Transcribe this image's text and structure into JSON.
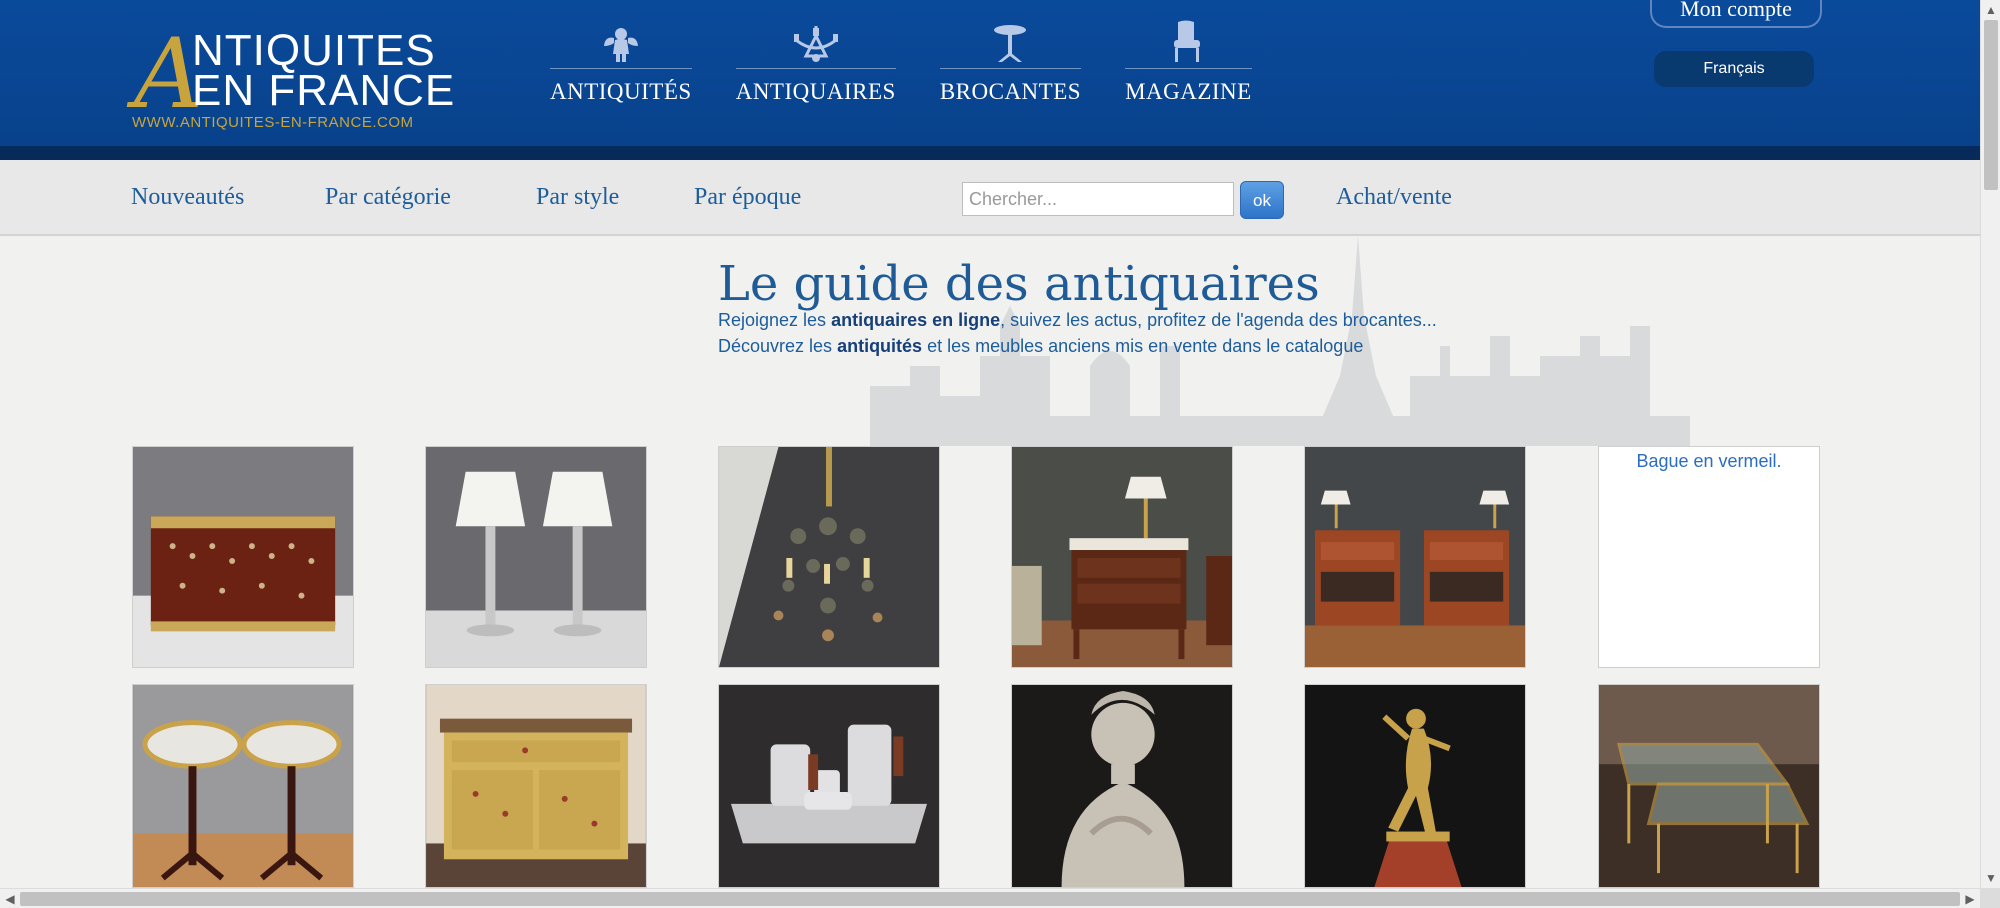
{
  "header": {
    "logo": {
      "initial": "A",
      "line1": "NTIQUITES",
      "line2": "EN FRANCE",
      "url": "WWW.ANTIQUITES-EN-FRANCE.COM"
    },
    "main_nav": [
      {
        "label": "ANTIQUITÉS",
        "icon": "cherub-icon"
      },
      {
        "label": "ANTIQUAIRES",
        "icon": "chandelier-icon"
      },
      {
        "label": "BROCANTES",
        "icon": "gueridon-table-icon"
      },
      {
        "label": "MAGAZINE",
        "icon": "armchair-icon"
      }
    ],
    "account_label": "Mon compte",
    "language": "Français"
  },
  "subnav": {
    "links": [
      "Nouveautés",
      "Par catégorie",
      "Par style",
      "Par époque"
    ],
    "search_placeholder": "Chercher...",
    "search_button": "ok",
    "buy_sell": "Achat/vente"
  },
  "intro": {
    "title": "Le guide des antiquaires",
    "line1": {
      "before": "Rejoignez les ",
      "bold": "antiquaires en ligne",
      "after": ", suivez les actus, profitez de l'agenda des brocantes..."
    },
    "line2": {
      "before": "Découvrez les ",
      "bold": "antiquités",
      "after": " et les meubles anciens mis en vente dans le catalogue"
    }
  },
  "products": {
    "row1": [
      "inlaid-casket-image",
      "silver-lamps-pair-image",
      "crystal-chandelier-image",
      "bedside-table-lamp-image",
      "pair-bedside-tables-image",
      "Bague en vermeil."
    ],
    "row2": [
      "marble-gueridons-pair-image",
      "painted-commode-image",
      "silver-tea-set-image",
      "marble-bust-image",
      "bronze-dancer-statue-image",
      "glass-nesting-tables-image"
    ]
  }
}
